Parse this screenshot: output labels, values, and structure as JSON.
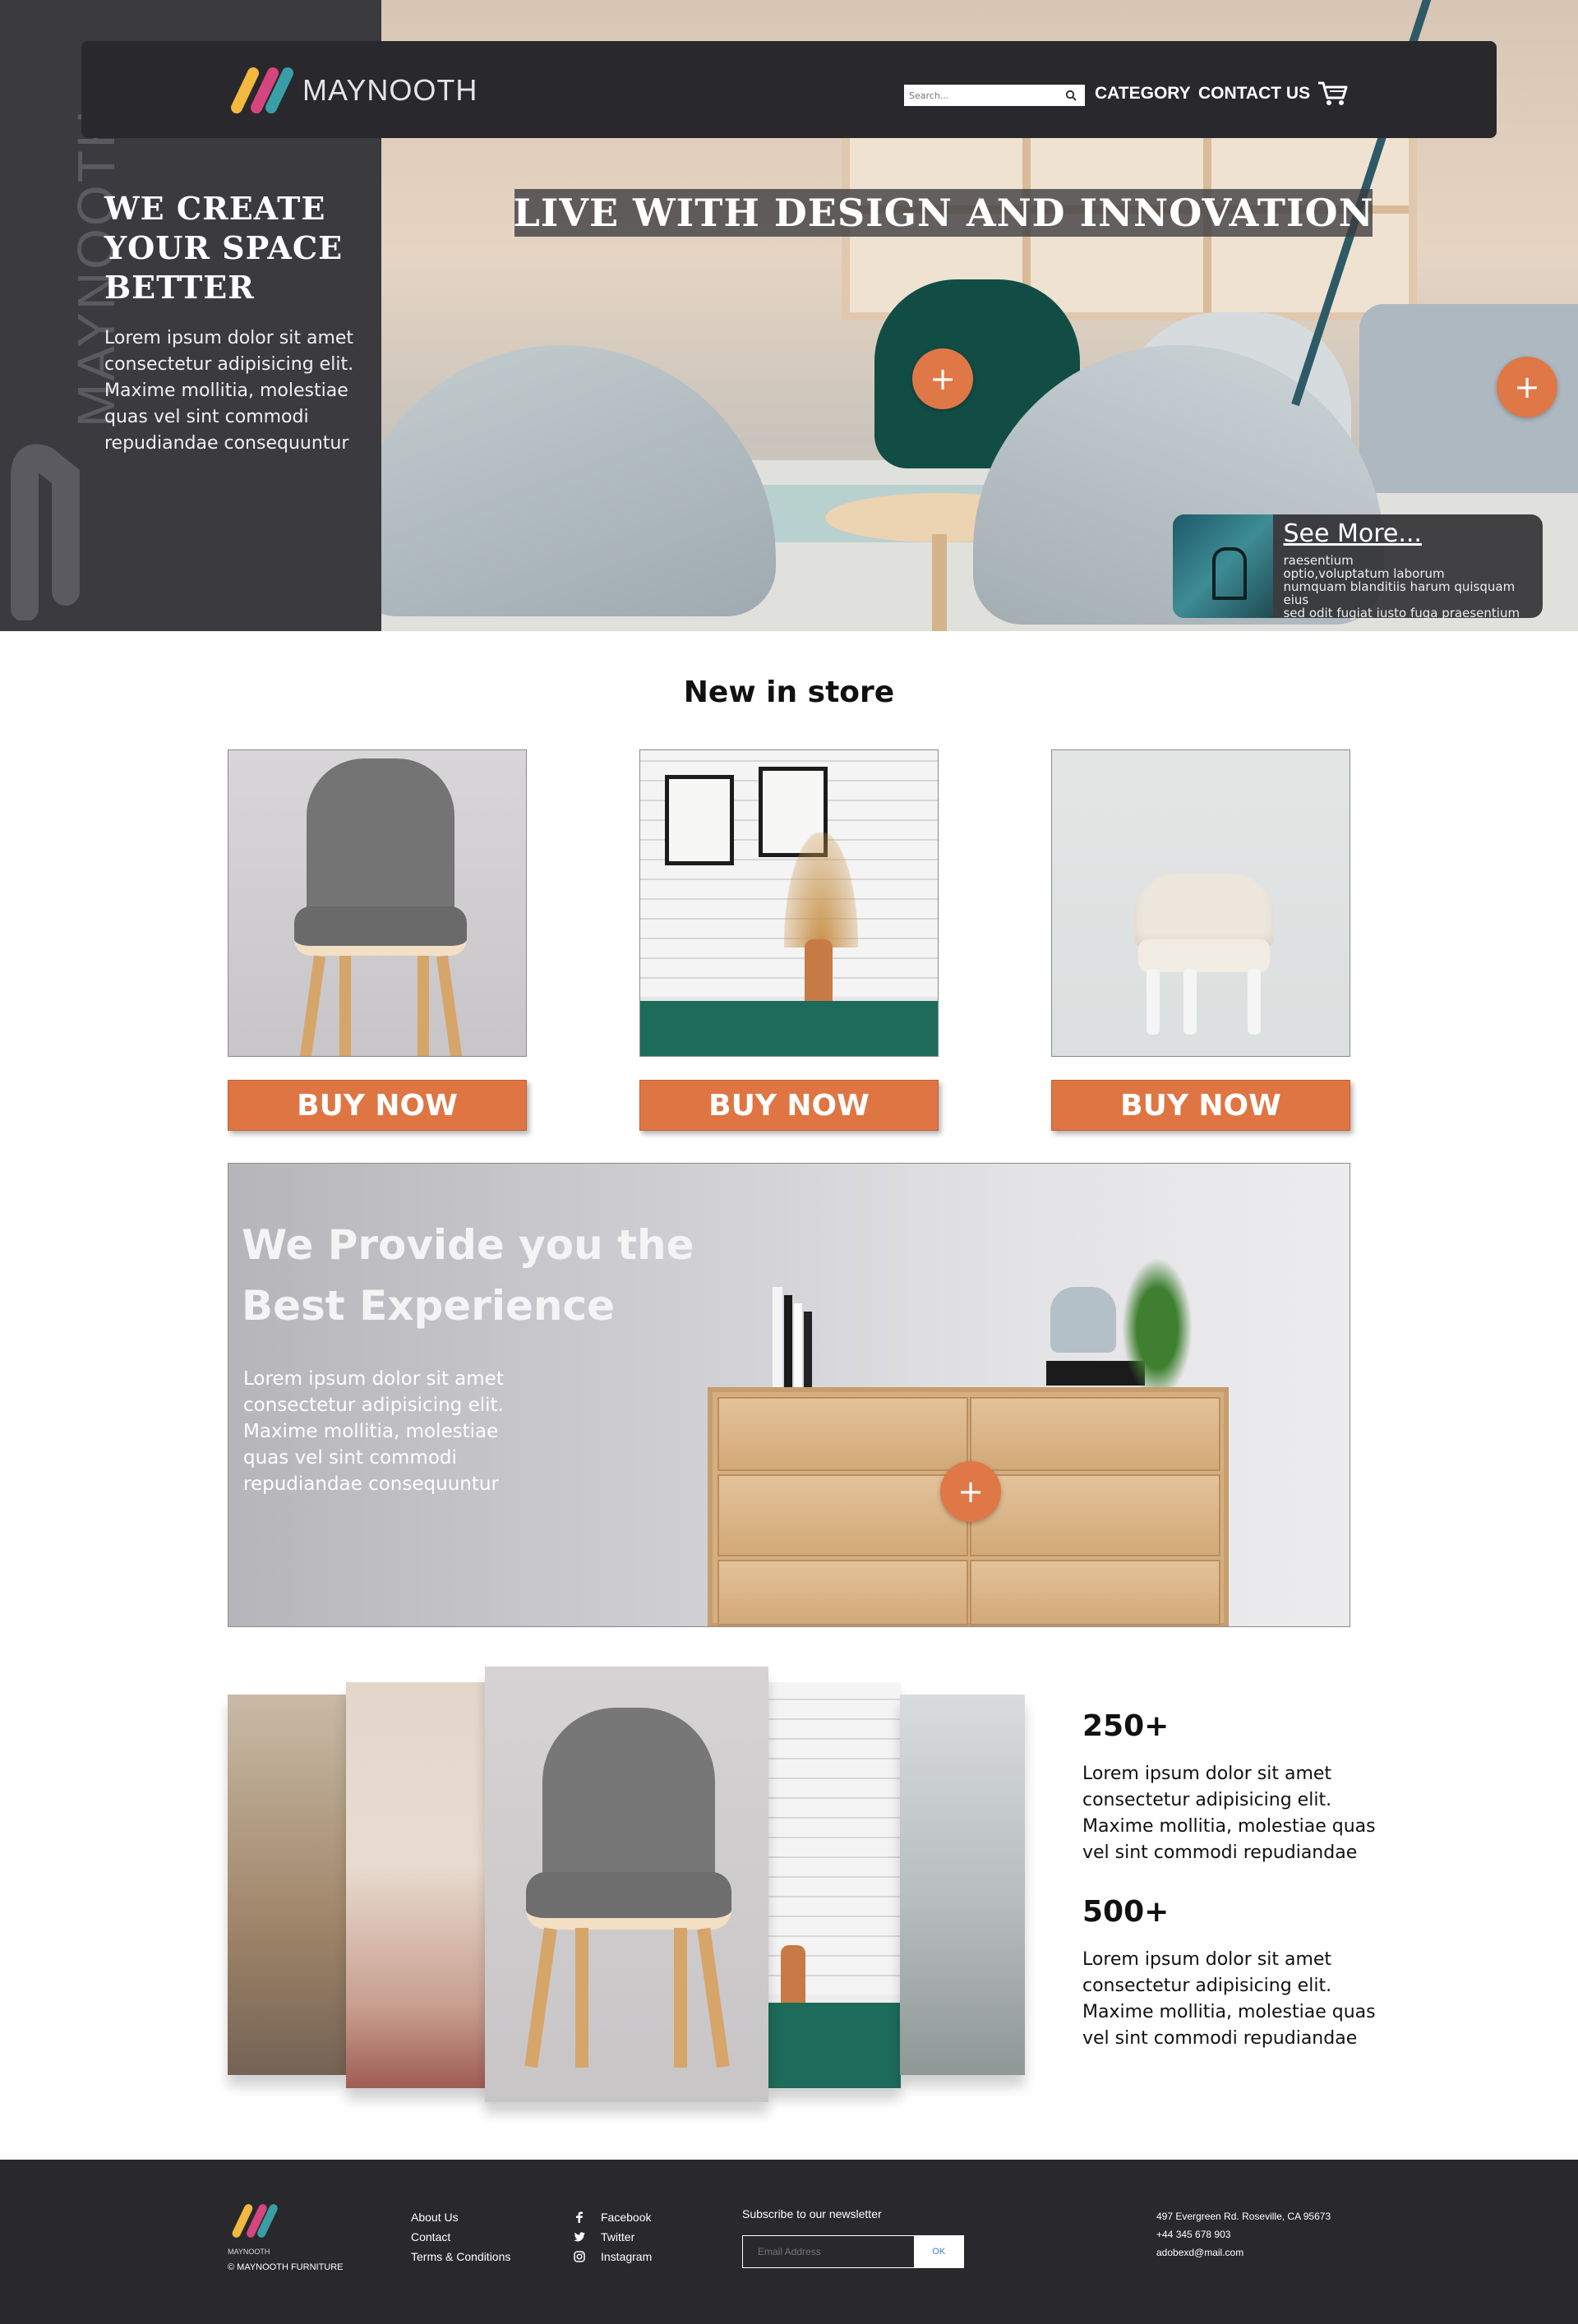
{
  "brand": {
    "name": "MAYNOOTH",
    "vertical_watermark": "MAYNOOTH",
    "logo_colors": [
      "#f2b840",
      "#d5467e",
      "#3a9ea6"
    ]
  },
  "nav": {
    "search_placeholder": "Search...",
    "links": [
      "CATEGORY",
      "CONTACT US"
    ],
    "cart_icon": "cart-icon"
  },
  "hero": {
    "headline": "WE CREATE YOUR SPACE BETTER",
    "body": "Lorem ipsum dolor sit amet consectetur adipisicing elit. Maxime mollitia, molestiae quas vel sint commodi repudiandae consequuntur",
    "banner": "LIVE WITH DESIGN AND INNOVATION",
    "plus_label": "+",
    "see_more": {
      "title": "See More...",
      "body": "raesentium\noptio,voluptatum laborum\nnumquam blanditiis harum quisquam eius\nsed odit fugiat iusto fuga praesentium"
    }
  },
  "new_in_store": {
    "title": "New in store",
    "buy_label": "BUY NOW"
  },
  "experience": {
    "title": "We Provide you the Best Experience",
    "body": "Lorem ipsum dolor sit amet consectetur adipisicing elit. Maxime mollitia, molestiae quas vel sint commodi repudiandae consequuntur",
    "plus_label": "+"
  },
  "stats": [
    {
      "number": "250+",
      "text": "Lorem ipsum dolor sit amet consectetur adipisicing elit. Maxime mollitia, molestiae quas vel sint commodi repudiandae"
    },
    {
      "number": "500+",
      "text": "Lorem ipsum dolor sit amet consectetur adipisicing elit. Maxime mollitia, molestiae quas vel sint commodi repudiandae"
    }
  ],
  "footer": {
    "brand_small": "MAYNOOTH",
    "copyright": "© MAYNOOTH FURNITURE",
    "links": [
      "About Us",
      "Contact",
      "Terms & Conditions"
    ],
    "social": [
      "Facebook",
      "Twitter",
      "Instagram"
    ],
    "newsletter_label": "Subscribe to our newsletter",
    "email_placeholder": "Email Address",
    "ok_label": "OK",
    "address": "497 Evergreen Rd. Roseville, CA 95673",
    "phone": "+44 345 678 903",
    "email": "adobexd@mail.com"
  },
  "colors": {
    "accent": "#df7543",
    "nav_bg": "#29282d",
    "side_panel": "#3b3a3f"
  }
}
